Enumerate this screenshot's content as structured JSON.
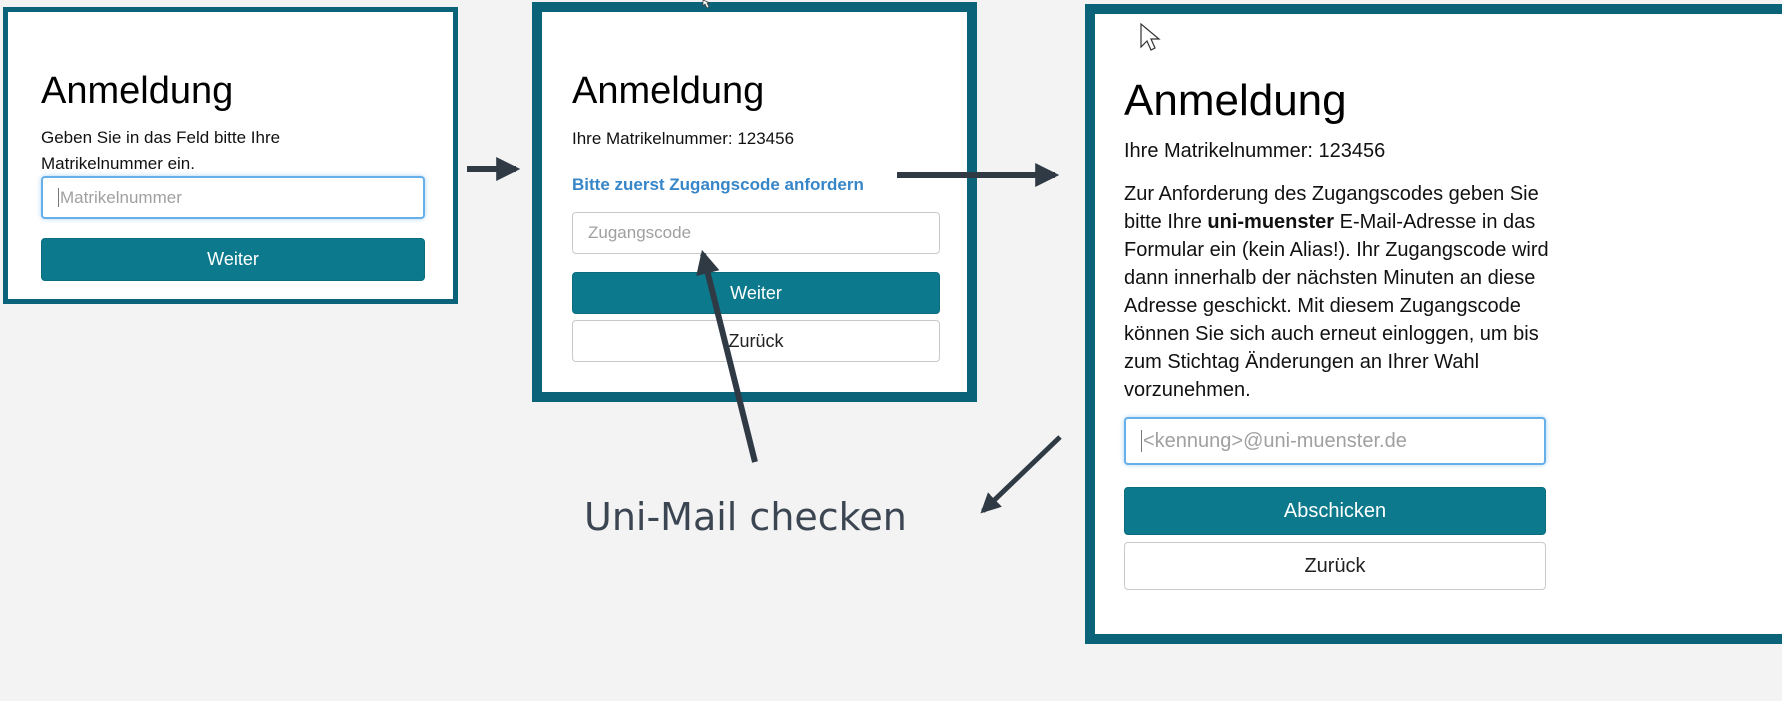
{
  "accent_color": "#0c7a8c",
  "frame_color": "#0b637a",
  "link_color": "#3786c8",
  "step1": {
    "title": "Anmeldung",
    "instruction_line1": "Geben Sie in das Feld bitte Ihre",
    "instruction_line2": "Matrikelnummer ein.",
    "matrikel_placeholder": "Matrikelnummer",
    "next_label": "Weiter"
  },
  "step2": {
    "title": "Anmeldung",
    "matrikel_text": "Ihre Matrikelnummer: 123456",
    "request_code_link": "Bitte zuerst Zugangscode anfordern",
    "code_placeholder": "Zugangscode",
    "next_label": "Weiter",
    "back_label": "Zurück"
  },
  "step3": {
    "title": "Anmeldung",
    "matrikel_text": "Ihre Matrikelnummer: 123456",
    "info_before_bold": "Zur Anforderung des Zugangscodes geben Sie bitte Ihre ",
    "info_bold": "uni-muenster",
    "info_after_bold": " E-Mail-Adresse in das Formular ein (kein Alias!). Ihr Zugangscode wird dann innerhalb der nächsten Minuten an diese Adresse geschickt. Mit diesem Zugangscode können Sie sich auch erneut einloggen, um bis zum Stichtag Änderungen an Ihrer Wahl vorzunehmen.",
    "email_placeholder": "<kennung>@uni-muenster.de",
    "submit_label": "Abschicken",
    "back_label": "Zurück"
  },
  "annotation": {
    "caption": "Uni-Mail checken",
    "arrow_color": "#2f3a45"
  }
}
